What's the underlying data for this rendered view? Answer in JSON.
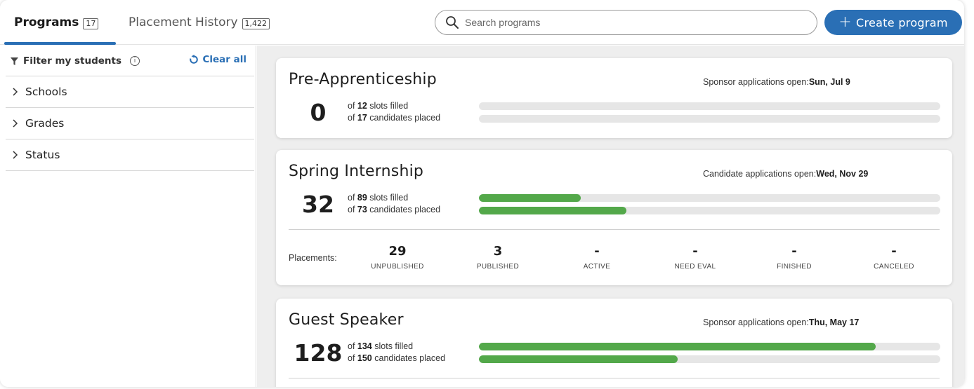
{
  "tabs": [
    {
      "label": "Programs",
      "count": "17",
      "active": true
    },
    {
      "label": "Placement History",
      "count": "1,422",
      "active": false
    }
  ],
  "search": {
    "placeholder": "Search programs"
  },
  "create_button": {
    "plus": "+",
    "label": "Create program"
  },
  "sidebar": {
    "filter_label": "Filter my students",
    "info_glyph": "i",
    "clear_label": "Clear all",
    "sections": [
      "Schools",
      "Grades",
      "Status"
    ]
  },
  "colors": {
    "accent": "#2a6fb5",
    "progress": "#53a84a",
    "track": "#e6e6e6"
  },
  "programs": [
    {
      "title": "Pre-Apprenticeship",
      "app_label": "Sponsor applications open",
      "app_date": "Sun, Jul 9",
      "big_number": "0",
      "slots_filled": "12",
      "slots_text": "slots filled",
      "candidates": "17",
      "candidates_text": "candidates placed",
      "slots_progress": 0,
      "candidates_progress": 0
    },
    {
      "title": "Spring Internship",
      "app_label": "Candidate applications open",
      "app_date": "Wed, Nov 29",
      "big_number": "32",
      "slots_filled": "89",
      "slots_text": "slots filled",
      "candidates": "73",
      "candidates_text": "candidates placed",
      "slots_progress": 0.22,
      "candidates_progress": 0.32,
      "placements_label": "Placements:",
      "placements": [
        {
          "value": "29",
          "label": "UNPUBLISHED"
        },
        {
          "value": "3",
          "label": "PUBLISHED"
        },
        {
          "value": "-",
          "label": "ACTIVE"
        },
        {
          "value": "-",
          "label": "NEED EVAL"
        },
        {
          "value": "-",
          "label": "FINISHED"
        },
        {
          "value": "-",
          "label": "CANCELED"
        }
      ]
    },
    {
      "title": "Guest Speaker",
      "app_label": "Sponsor applications open",
      "app_date": "Thu, May 17",
      "big_number": "128",
      "slots_filled": "134",
      "slots_text": "slots filled",
      "candidates": "150",
      "candidates_text": "candidates placed",
      "slots_progress": 0.86,
      "candidates_progress": 0.43
    }
  ]
}
